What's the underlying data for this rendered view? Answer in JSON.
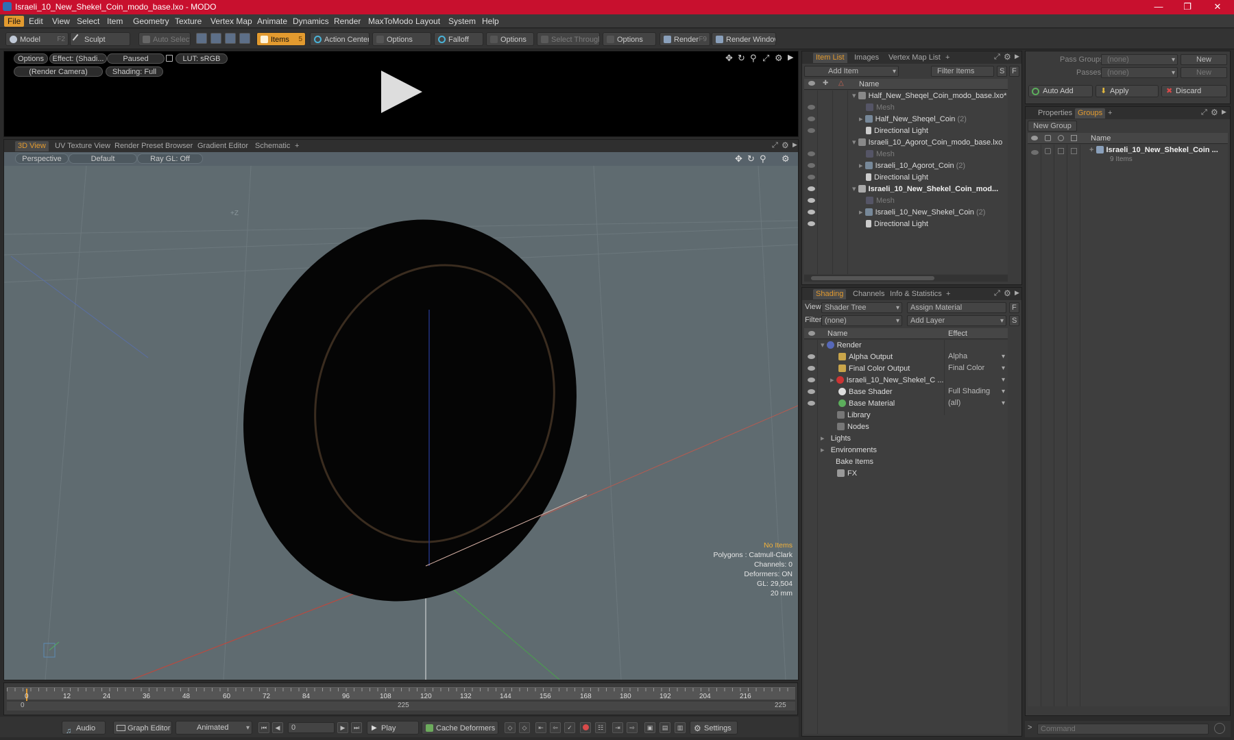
{
  "window": {
    "title": "Israeli_10_New_Shekel_Coin_modo_base.lxo - MODO",
    "minimize": "—",
    "maximize": "❐",
    "close": "✕"
  },
  "menu": [
    "File",
    "Edit",
    "View",
    "Select",
    "Item",
    "Geometry",
    "Texture",
    "Vertex Map",
    "Animate",
    "Dynamics",
    "Render",
    "MaxToModo",
    "Layout",
    "System",
    "Help"
  ],
  "toolbar": {
    "model": "Model",
    "model_key": "F2",
    "sculpt": "Sculpt",
    "auto_select": "Auto Select",
    "items": "Items",
    "items_key": "5",
    "action_center": "Action Center",
    "options1": "Options",
    "falloff": "Falloff",
    "options2": "Options",
    "select_through": "Select Through",
    "options3": "Options",
    "render": "Render",
    "render_key": "F9",
    "render_window": "Render Window"
  },
  "render_preview": {
    "options": "Options",
    "effect": "Effect: (Shadi...",
    "paused": "Paused",
    "lut": "LUT: sRGB",
    "camera": "(Render Camera)",
    "shading": "Shading: Full"
  },
  "viewport": {
    "tabs": [
      "3D View",
      "UV Texture View",
      "Render Preset Browser",
      "Gradient Editor",
      "Schematic"
    ],
    "add_tab": "+",
    "perspective": "Perspective",
    "default": "Default",
    "raygl": "Ray GL: Off",
    "axis_label": "+Z",
    "stats": {
      "no_items": "No Items",
      "polygons": "Polygons : Catmull-Clark",
      "channels": "Channels: 0",
      "deformers": "Deformers: ON",
      "gl": "GL: 29,504",
      "scale": "20 mm"
    }
  },
  "timeline": {
    "ticks": [
      "0",
      "12",
      "24",
      "36",
      "48",
      "60",
      "72",
      "84",
      "96",
      "108",
      "120",
      "132",
      "144",
      "156",
      "168",
      "180",
      "192",
      "204",
      "216"
    ],
    "range_start": "0",
    "range_mid": "225",
    "range_end": "225"
  },
  "bottombar": {
    "audio": "Audio",
    "graph_editor": "Graph Editor",
    "animated": "Animated",
    "frame": "0",
    "play": "Play",
    "cache_deformers": "Cache Deformers",
    "settings": "Settings"
  },
  "item_list": {
    "tabs": [
      "Item List",
      "Images",
      "Vertex Map List"
    ],
    "add_tab": "+",
    "add_item": "Add Item",
    "filter_items": "Filter Items",
    "s": "S",
    "f": "F",
    "col_name": "Name",
    "rows": [
      {
        "label": "Half_New_Sheqel_Coin_modo_base.lxo*",
        "count": ""
      },
      {
        "label": "Mesh",
        "count": ""
      },
      {
        "label": "Half_New_Sheqel_Coin",
        "count": "(2)"
      },
      {
        "label": "Directional Light",
        "count": ""
      },
      {
        "label": "Israeli_10_Agorot_Coin_modo_base.lxo",
        "count": ""
      },
      {
        "label": "Mesh",
        "count": ""
      },
      {
        "label": "Israeli_10_Agorot_Coin",
        "count": "(2)"
      },
      {
        "label": "Directional Light",
        "count": ""
      },
      {
        "label": "Israeli_10_New_Shekel_Coin_mod...",
        "count": ""
      },
      {
        "label": "Mesh",
        "count": ""
      },
      {
        "label": "Israeli_10_New_Shekel_Coin",
        "count": "(2)"
      },
      {
        "label": "Directional Light",
        "count": ""
      }
    ]
  },
  "shading": {
    "tabs": [
      "Shading",
      "Channels",
      "Info & Statistics"
    ],
    "add_tab": "+",
    "view_label": "View",
    "view_value": "Shader Tree",
    "assign_material": "Assign Material",
    "f": "F",
    "filter_label": "Filter",
    "filter_value": "(none)",
    "add_layer": "Add Layer",
    "s": "S",
    "col_name": "Name",
    "col_effect": "Effect",
    "rows": [
      {
        "label": "Render",
        "effect": ""
      },
      {
        "label": "Alpha Output",
        "effect": "Alpha"
      },
      {
        "label": "Final Color Output",
        "effect": "Final Color"
      },
      {
        "label": "Israeli_10_New_Shekel_C ...",
        "effect": ""
      },
      {
        "label": "Base Shader",
        "effect": "Full Shading"
      },
      {
        "label": "Base Material",
        "effect": "(all)"
      },
      {
        "label": "Library",
        "effect": ""
      },
      {
        "label": "Nodes",
        "effect": ""
      },
      {
        "label": "Lights",
        "effect": ""
      },
      {
        "label": "Environments",
        "effect": ""
      },
      {
        "label": "Bake Items",
        "effect": ""
      },
      {
        "label": "FX",
        "effect": ""
      }
    ]
  },
  "pass_groups": {
    "pass_groups_label": "Pass Groups",
    "pass_groups_value": "(none)",
    "new": "New",
    "passes_label": "Passes",
    "passes_value": "(none)",
    "new2": "New",
    "auto_add": "Auto Add",
    "apply": "Apply",
    "discard": "Discard"
  },
  "groups": {
    "tabs": [
      "Properties",
      "Groups"
    ],
    "add_tab": "+",
    "new_group": "New Group",
    "col_name": "Name",
    "group_name": "Israeli_10_New_Shekel_Coin ...",
    "group_count": "9 Items"
  },
  "command": {
    "placeholder": "Command"
  },
  "colors": {
    "accent": "#e29a2f",
    "titlebar": "#c8102e",
    "viewport_bg": "#5f6b70"
  }
}
